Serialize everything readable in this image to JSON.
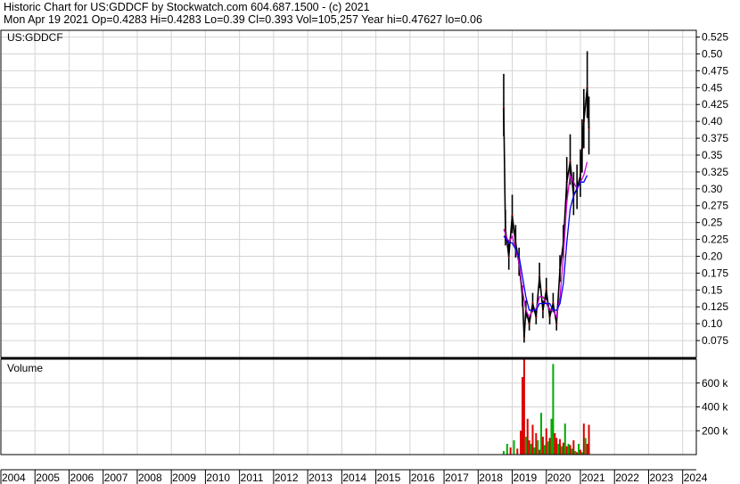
{
  "header": {
    "line1": "Historic Chart for US:GDDCF by Stockwatch.com 604.687.1500 - (c) 2021",
    "line2": "Mon Apr 19 2021   Op=0.4283   Hi=0.4283   Lo=0.39   Cl=0.393   Vol=105,257   Year hi=0.47627   lo=0.06"
  },
  "colors": {
    "grid": "#d4d4d4",
    "price_bar": "#000000",
    "price_dot": "#cc0000",
    "ma_fast": "#cc00cc",
    "ma_slow": "#0000ee",
    "vol_up": "#00aa00",
    "vol_down": "#dd0000"
  },
  "chart_data": [
    {
      "type": "line",
      "title": "US:GDDCF",
      "ylim": [
        0.05,
        0.535
      ],
      "y_ticks": [
        "0.525",
        "0.50",
        "0.475",
        "0.45",
        "0.425",
        "0.40",
        "0.375",
        "0.35",
        "0.325",
        "0.30",
        "0.275",
        "0.25",
        "0.225",
        "0.20",
        "0.175",
        "0.15",
        "0.125",
        "0.10",
        "0.075"
      ],
      "y_tick_values": [
        0.525,
        0.5,
        0.475,
        0.45,
        0.425,
        0.4,
        0.375,
        0.35,
        0.325,
        0.3,
        0.275,
        0.25,
        0.225,
        0.2,
        0.175,
        0.15,
        0.125,
        0.1,
        0.075
      ],
      "xlim": [
        2004.0,
        2024.4
      ],
      "grid": true,
      "series": [
        {
          "x": [
            2018.75,
            2018.8,
            2018.9,
            2019.0,
            2019.1,
            2019.2,
            2019.3,
            2019.35,
            2019.4,
            2019.5,
            2019.6,
            2019.7,
            2019.8,
            2019.9,
            2020.0,
            2020.1,
            2020.2,
            2020.3,
            2020.4,
            2020.5,
            2020.6,
            2020.7,
            2020.8,
            2020.9,
            2021.0,
            2021.05,
            2021.1,
            2021.2,
            2021.25
          ],
          "values": [
            0.42,
            0.24,
            0.2,
            0.26,
            0.22,
            0.19,
            0.14,
            0.08,
            0.12,
            0.1,
            0.13,
            0.11,
            0.17,
            0.12,
            0.15,
            0.11,
            0.13,
            0.1,
            0.18,
            0.22,
            0.31,
            0.34,
            0.29,
            0.3,
            0.32,
            0.36,
            0.4,
            0.45,
            0.39
          ]
        },
        {
          "name": "",
          "x": [
            2018.75,
            2018.9,
            2019.0,
            2019.1,
            2019.2,
            2019.3,
            2019.4,
            2019.5,
            2019.6,
            2019.7,
            2019.8,
            2019.9,
            2020.0,
            2020.1,
            2020.2,
            2020.3,
            2020.4,
            2020.5,
            2020.6,
            2020.7,
            2020.8,
            2020.9,
            2021.0,
            2021.1,
            2021.2
          ],
          "values": [
            0.24,
            0.22,
            0.23,
            0.21,
            0.19,
            0.15,
            0.12,
            0.11,
            0.12,
            0.12,
            0.14,
            0.14,
            0.13,
            0.12,
            0.12,
            0.11,
            0.14,
            0.2,
            0.28,
            0.32,
            0.31,
            0.3,
            0.31,
            0.32,
            0.34
          ]
        },
        {
          "name": "",
          "x": [
            2018.75,
            2018.9,
            2019.0,
            2019.1,
            2019.2,
            2019.3,
            2019.4,
            2019.5,
            2019.6,
            2019.7,
            2019.8,
            2019.9,
            2020.0,
            2020.1,
            2020.2,
            2020.3,
            2020.4,
            2020.5,
            2020.6,
            2020.7,
            2020.8,
            2020.9,
            2021.0,
            2021.1,
            2021.2
          ],
          "values": [
            0.23,
            0.22,
            0.22,
            0.21,
            0.2,
            0.17,
            0.14,
            0.12,
            0.12,
            0.12,
            0.13,
            0.13,
            0.13,
            0.13,
            0.12,
            0.12,
            0.13,
            0.16,
            0.22,
            0.27,
            0.29,
            0.3,
            0.31,
            0.31,
            0.32
          ]
        }
      ]
    },
    {
      "type": "bar",
      "title": "Volume",
      "ylim": [
        0,
        800000
      ],
      "y_ticks": [
        "600 k",
        "400 k",
        "200 k"
      ],
      "y_tick_values": [
        600000,
        400000,
        200000
      ],
      "xlim": [
        2004.0,
        2024.4
      ],
      "series": [
        {
          "x": [
            2018.75,
            2018.85,
            2018.95,
            2019.05,
            2019.15,
            2019.25,
            2019.3,
            2019.35,
            2019.4,
            2019.45,
            2019.5,
            2019.55,
            2019.6,
            2019.65,
            2019.7,
            2019.75,
            2019.8,
            2019.85,
            2019.9,
            2019.95,
            2020.0,
            2020.05,
            2020.1,
            2020.15,
            2020.2,
            2020.25,
            2020.3,
            2020.35,
            2020.4,
            2020.45,
            2020.5,
            2020.55,
            2020.6,
            2020.65,
            2020.7,
            2020.75,
            2020.8,
            2020.85,
            2020.9,
            2020.95,
            2021.0,
            2021.05,
            2021.1,
            2021.15,
            2021.2,
            2021.25
          ],
          "values": [
            30000,
            90000,
            60000,
            120000,
            50000,
            200000,
            650000,
            800000,
            150000,
            300000,
            120000,
            90000,
            250000,
            60000,
            180000,
            120000,
            40000,
            350000,
            150000,
            80000,
            220000,
            110000,
            140000,
            300000,
            760000,
            180000,
            140000,
            90000,
            130000,
            70000,
            100000,
            260000,
            70000,
            90000,
            80000,
            50000,
            120000,
            30000,
            20000,
            90000,
            40000,
            20000,
            260000,
            140000,
            90000,
            250000
          ],
          "up": [
            1,
            1,
            0,
            1,
            0,
            0,
            0,
            0,
            1,
            0,
            0,
            1,
            0,
            1,
            0,
            1,
            0,
            1,
            0,
            1,
            0,
            1,
            0,
            1,
            1,
            0,
            0,
            1,
            0,
            1,
            0,
            1,
            0,
            1,
            0,
            1,
            0,
            1,
            0,
            1,
            0,
            1,
            0,
            1,
            0,
            0
          ]
        }
      ]
    },
    {
      "type": "axis",
      "x_ticks": [
        "2004",
        "2005",
        "2006",
        "2007",
        "2008",
        "2009",
        "2010",
        "2011",
        "2012",
        "2013",
        "2014",
        "2015",
        "2016",
        "2017",
        "2018",
        "2019",
        "2020",
        "2021",
        "2022",
        "2023",
        "2024"
      ]
    }
  ]
}
